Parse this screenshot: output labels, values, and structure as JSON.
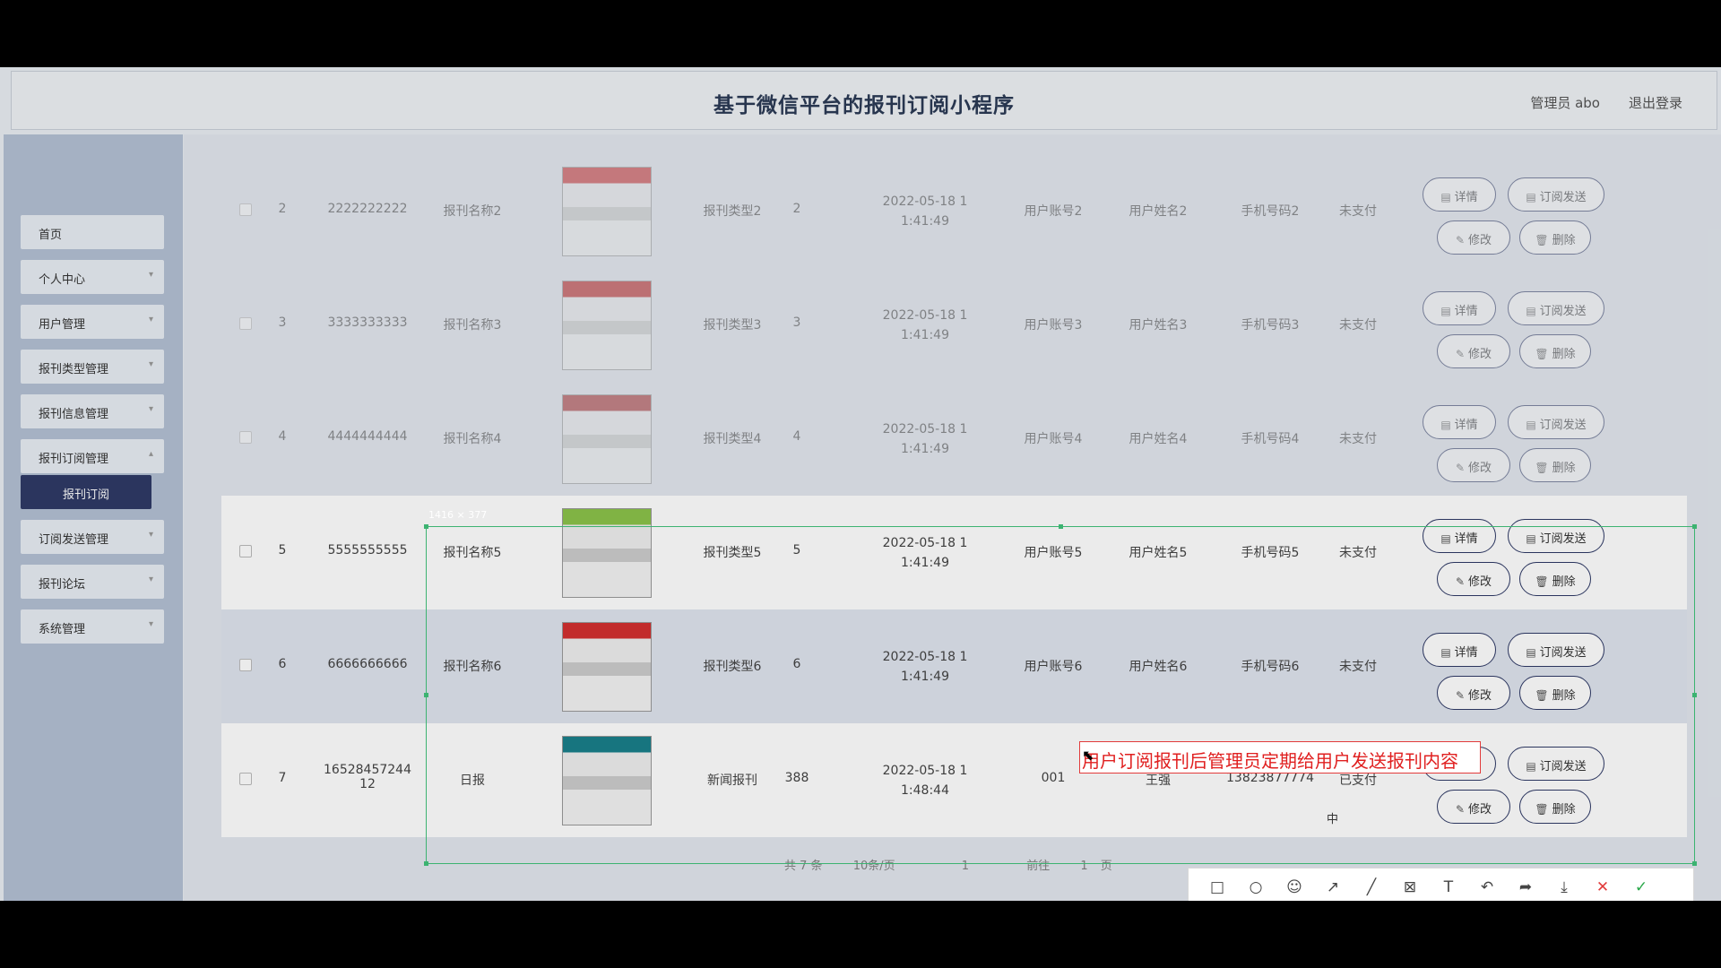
{
  "header": {
    "title": "基于微信平台的报刊订阅小程序",
    "admin": "管理员 abo",
    "logout": "退出登录"
  },
  "sidebar": {
    "items": [
      {
        "label": "首页"
      },
      {
        "label": "个人中心"
      },
      {
        "label": "用户管理"
      },
      {
        "label": "报刊类型管理"
      },
      {
        "label": "报刊信息管理"
      },
      {
        "label": "报刊订阅管理"
      },
      {
        "label": "订阅发送管理"
      },
      {
        "label": "报刊论坛"
      },
      {
        "label": "系统管理"
      }
    ],
    "active_sub": "报刊订阅"
  },
  "table": {
    "rows": [
      {
        "index": "2",
        "order_no": "2222222222",
        "name": "报刊名称2",
        "type": "报刊类型2",
        "qty": "2",
        "time1": "2022-05-18 1",
        "time2": "1:41:49",
        "account": "用户账号2",
        "username": "用户姓名2",
        "phone": "手机号码2",
        "status": "未支付",
        "thumb_color": "#c33"
      },
      {
        "index": "3",
        "order_no": "3333333333",
        "name": "报刊名称3",
        "type": "报刊类型3",
        "qty": "3",
        "time1": "2022-05-18 1",
        "time2": "1:41:49",
        "account": "用户账号3",
        "username": "用户姓名3",
        "phone": "手机号码3",
        "status": "未支付",
        "thumb_color": "#b22"
      },
      {
        "index": "4",
        "order_no": "4444444444",
        "name": "报刊名称4",
        "type": "报刊类型4",
        "qty": "4",
        "time1": "2022-05-18 1",
        "time2": "1:41:49",
        "account": "用户账号4",
        "username": "用户姓名4",
        "phone": "手机号码4",
        "status": "未支付",
        "thumb_color": "#a33"
      },
      {
        "index": "5",
        "order_no": "5555555555",
        "name": "报刊名称5",
        "type": "报刊类型5",
        "qty": "5",
        "time1": "2022-05-18 1",
        "time2": "1:41:49",
        "account": "用户账号5",
        "username": "用户姓名5",
        "phone": "手机号码5",
        "status": "未支付",
        "thumb_color": "#8bc34a"
      },
      {
        "index": "6",
        "order_no": "6666666666",
        "name": "报刊名称6",
        "type": "报刊类型6",
        "qty": "6",
        "time1": "2022-05-18 1",
        "time2": "1:41:49",
        "account": "用户账号6",
        "username": "用户姓名6",
        "phone": "手机号码6",
        "status": "未支付",
        "thumb_color": "#d32f2f"
      },
      {
        "index": "7",
        "order_no": "16528457244",
        "order_no2": "12",
        "name": "日报",
        "type": "新闻报刊",
        "qty": "388",
        "time1": "2022-05-18 1",
        "time2": "1:48:44",
        "account": "001",
        "username": "王强",
        "phone": "13823877774",
        "status": "已支付",
        "thumb_color": "#1a7f8a"
      }
    ],
    "buttons": {
      "detail": "详情",
      "send": "订阅发送",
      "edit": "修改",
      "delete": "删除"
    }
  },
  "capture": {
    "size_label": "1416 × 377",
    "annotation": "用户订阅报刊后管理员定期给用户发送报刊内容"
  },
  "pagination": {
    "total": "共 7 条",
    "per_page": "10条/页",
    "page": "1",
    "goto": "前往",
    "goto_page": "1",
    "page_unit": "页"
  },
  "toolbar": {
    "tools": [
      "rect-icon",
      "ellipse-icon",
      "mosaic-icon",
      "arrow-icon",
      "pen-icon",
      "blur-icon",
      "text-icon",
      "undo-icon",
      "share-icon",
      "save-icon",
      "close-icon",
      "confirm-icon"
    ]
  },
  "tray": {
    "ime": "中"
  }
}
